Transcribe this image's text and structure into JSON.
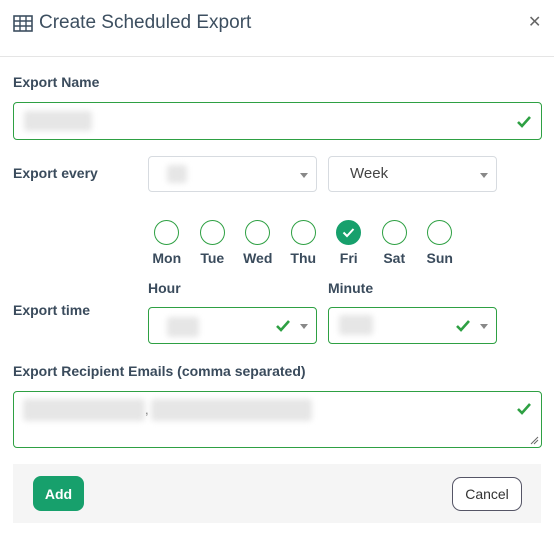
{
  "dialog": {
    "title": "Create Scheduled Export",
    "title_icon": "table-grid-icon",
    "close_icon": "close-icon"
  },
  "export_name": {
    "label": "Export Name",
    "value": "",
    "valid": true
  },
  "export_every": {
    "label": "Export every",
    "count_value": "",
    "unit_value": "Week"
  },
  "days": [
    {
      "label": "Mon",
      "selected": false
    },
    {
      "label": "Tue",
      "selected": false
    },
    {
      "label": "Wed",
      "selected": false
    },
    {
      "label": "Thu",
      "selected": false
    },
    {
      "label": "Fri",
      "selected": true
    },
    {
      "label": "Sat",
      "selected": false
    },
    {
      "label": "Sun",
      "selected": false
    }
  ],
  "export_time": {
    "label": "Export time",
    "hour_label": "Hour",
    "hour_value": "",
    "minute_label": "Minute",
    "minute_value": ""
  },
  "recipients": {
    "label": "Export Recipient Emails (comma separated)",
    "value": "",
    "separator": ","
  },
  "footer": {
    "add_label": "Add",
    "cancel_label": "Cancel"
  },
  "colors": {
    "accent": "#17a06c",
    "valid_border": "#2ea043",
    "label_text": "#3a4b5c"
  }
}
